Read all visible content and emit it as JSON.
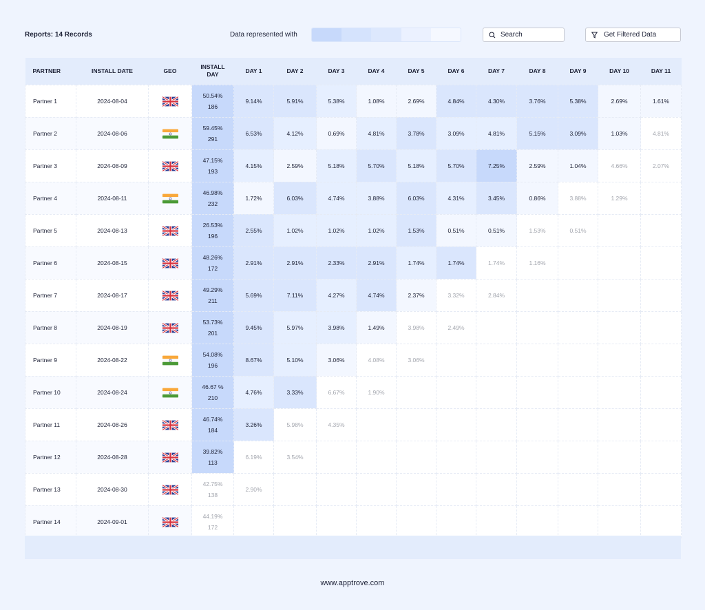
{
  "header": {
    "records_label": "Reports: 14 Records",
    "legend_label": "Data represented with",
    "legend_colors": [
      "#c7d9fb",
      "#d5e3fd",
      "#dde8fd",
      "#ebf1ff",
      "#f5f8ff"
    ],
    "search_placeholder": "Search",
    "search_icon": "search-icon",
    "filter_label": "Get Filtered Data",
    "filter_icon": "filter-icon"
  },
  "table": {
    "columns": [
      "PARTNER",
      "INSTALL DATE",
      "GEO",
      "INSTALL DAY",
      "DAY 1",
      "DAY 2",
      "DAY 3",
      "DAY 4",
      "DAY 5",
      "DAY 6",
      "DAY 7",
      "DAY 8",
      "DAY 9",
      "DAY 10",
      "DAY 11"
    ],
    "rows": [
      {
        "partner": "Partner 1",
        "date": "2024-08-04",
        "geo": "UK",
        "install_pct": "50.54%",
        "install_count": "186",
        "install_level": 4,
        "days": [
          [
            "9.14%",
            3
          ],
          [
            "5.91%",
            3
          ],
          [
            "5.38%",
            2
          ],
          [
            "1.08%",
            1
          ],
          [
            "2.69%",
            1
          ],
          [
            "4.84%",
            3
          ],
          [
            "4.30%",
            3
          ],
          [
            "3.76%",
            3
          ],
          [
            "5.38%",
            3
          ],
          [
            "2.69%",
            1
          ],
          [
            "1.61%",
            1
          ]
        ]
      },
      {
        "partner": "Partner 2",
        "date": "2024-08-06",
        "geo": "India",
        "install_pct": "59.45%",
        "install_count": "291",
        "install_level": 4,
        "days": [
          [
            "6.53%",
            3
          ],
          [
            "4.12%",
            2
          ],
          [
            "0.69%",
            1
          ],
          [
            "4.81%",
            2
          ],
          [
            "3.78%",
            3
          ],
          [
            "3.09%",
            2
          ],
          [
            "4.81%",
            2
          ],
          [
            "5.15%",
            3
          ],
          [
            "3.09%",
            3
          ],
          [
            "1.03%",
            1
          ],
          [
            "4.81%",
            0
          ]
        ]
      },
      {
        "partner": "Partner 3",
        "date": "2024-08-09",
        "geo": "UK",
        "install_pct": "47.15%",
        "install_count": "193",
        "install_level": 4,
        "days": [
          [
            "4.15%",
            2
          ],
          [
            "2.59%",
            1
          ],
          [
            "5.18%",
            2
          ],
          [
            "5.70%",
            3
          ],
          [
            "5.18%",
            2
          ],
          [
            "5.70%",
            3
          ],
          [
            "7.25%",
            4
          ],
          [
            "2.59%",
            1
          ],
          [
            "1.04%",
            1
          ],
          [
            "4.66%",
            0
          ],
          [
            "2.07%",
            0
          ]
        ]
      },
      {
        "partner": "Partner 4",
        "date": "2024-08-11",
        "geo": "India",
        "install_pct": "46.98%",
        "install_count": "232",
        "install_level": 4,
        "days": [
          [
            "1.72%",
            1
          ],
          [
            "6.03%",
            3
          ],
          [
            "4.74%",
            2
          ],
          [
            "3.88%",
            2
          ],
          [
            "6.03%",
            3
          ],
          [
            "4.31%",
            2
          ],
          [
            "3.45%",
            3
          ],
          [
            "0.86%",
            1
          ],
          [
            "3.88%",
            0
          ],
          [
            "1.29%",
            0
          ],
          null
        ]
      },
      {
        "partner": "Partner 5",
        "date": "2024-08-13",
        "geo": "UK",
        "install_pct": "26.53%",
        "install_count": "196",
        "install_level": 4,
        "days": [
          [
            "2.55%",
            3
          ],
          [
            "1.02%",
            2
          ],
          [
            "1.02%",
            2
          ],
          [
            "1.02%",
            2
          ],
          [
            "1.53%",
            3
          ],
          [
            "0.51%",
            1
          ],
          [
            "0.51%",
            1
          ],
          [
            "1.53%",
            0
          ],
          [
            "0.51%",
            0
          ],
          null,
          null
        ]
      },
      {
        "partner": "Partner 6",
        "date": "2024-08-15",
        "geo": "UK",
        "install_pct": "48.26%",
        "install_count": "172",
        "install_level": 4,
        "days": [
          [
            "2.91%",
            3
          ],
          [
            "2.91%",
            3
          ],
          [
            "2.33%",
            3
          ],
          [
            "2.91%",
            3
          ],
          [
            "1.74%",
            2
          ],
          [
            "1.74%",
            3
          ],
          [
            "1.74%",
            0
          ],
          [
            "1.16%",
            0
          ],
          null,
          null,
          null
        ]
      },
      {
        "partner": "Partner 7",
        "date": "2024-08-17",
        "geo": "UK",
        "install_pct": "49.29%",
        "install_count": "211",
        "install_level": 4,
        "days": [
          [
            "5.69%",
            3
          ],
          [
            "7.11%",
            3
          ],
          [
            "4.27%",
            2
          ],
          [
            "4.74%",
            3
          ],
          [
            "2.37%",
            1
          ],
          [
            "3.32%",
            0
          ],
          [
            "2.84%",
            0
          ],
          null,
          null,
          null,
          null
        ]
      },
      {
        "partner": "Partner 8",
        "date": "2024-08-19",
        "geo": "UK",
        "install_pct": "53.73%",
        "install_count": "201",
        "install_level": 4,
        "days": [
          [
            "9.45%",
            3
          ],
          [
            "5.97%",
            2
          ],
          [
            "3.98%",
            2
          ],
          [
            "1.49%",
            1
          ],
          [
            "3.98%",
            0
          ],
          [
            "2.49%",
            0
          ],
          null,
          null,
          null,
          null,
          null
        ]
      },
      {
        "partner": "Partner 9",
        "date": "2024-08-22",
        "geo": "India",
        "install_pct": "54.08%",
        "install_count": "196",
        "install_level": 4,
        "days": [
          [
            "8.67%",
            3
          ],
          [
            "5.10%",
            2
          ],
          [
            "3.06%",
            1
          ],
          [
            "4.08%",
            0
          ],
          [
            "3.06%",
            0
          ],
          null,
          null,
          null,
          null,
          null,
          null
        ]
      },
      {
        "partner": "Partner 10",
        "date": "2024-08-24",
        "geo": "India",
        "install_pct": "46.67 %",
        "install_count": "210",
        "install_level": 4,
        "days": [
          [
            "4.76%",
            2
          ],
          [
            "3.33%",
            3
          ],
          [
            "6.67%",
            0
          ],
          [
            "1.90%",
            0
          ],
          null,
          null,
          null,
          null,
          null,
          null,
          null
        ]
      },
      {
        "partner": "Partner 11",
        "date": "2024-08-26",
        "geo": "UK",
        "install_pct": "46.74%",
        "install_count": "184",
        "install_level": 4,
        "days": [
          [
            "3.26%",
            3
          ],
          [
            "5.98%",
            0
          ],
          [
            "4.35%",
            0
          ],
          null,
          null,
          null,
          null,
          null,
          null,
          null,
          null
        ]
      },
      {
        "partner": "Partner 12",
        "date": "2024-08-28",
        "geo": "UK",
        "install_pct": "39.82%",
        "install_count": "113",
        "install_level": 4,
        "days": [
          [
            "6.19%",
            0
          ],
          [
            "3.54%",
            0
          ],
          null,
          null,
          null,
          null,
          null,
          null,
          null,
          null,
          null
        ]
      },
      {
        "partner": "Partner 13",
        "date": "2024-08-30",
        "geo": "UK",
        "install_pct": "42.75%",
        "install_count": "138",
        "install_level": 0,
        "days": [
          [
            "2.90%",
            0
          ],
          null,
          null,
          null,
          null,
          null,
          null,
          null,
          null,
          null,
          null
        ]
      },
      {
        "partner": "Partner 14",
        "date": "2024-09-01",
        "geo": "UK",
        "install_pct": "44.19%",
        "install_count": "172",
        "install_level": 0,
        "days": [
          null,
          null,
          null,
          null,
          null,
          null,
          null,
          null,
          null,
          null,
          null
        ]
      }
    ]
  },
  "footer": {
    "website": "www.apptrove.com"
  }
}
